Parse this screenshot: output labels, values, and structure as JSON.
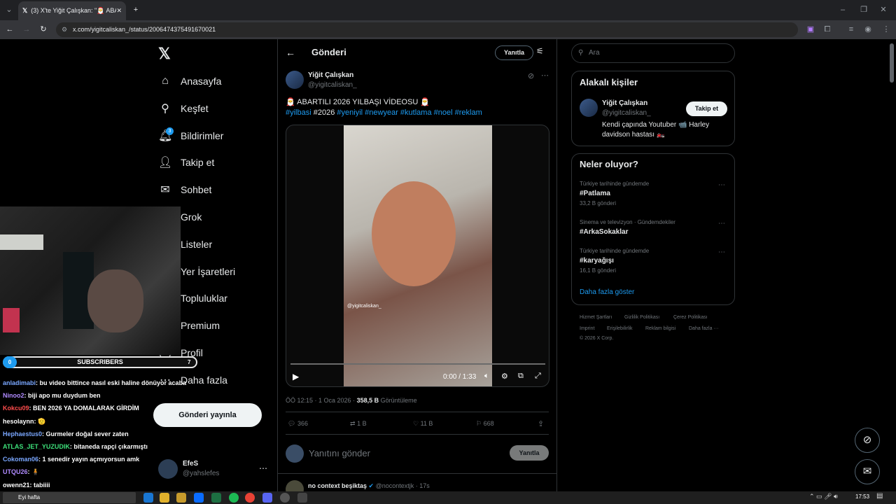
{
  "browser": {
    "tab_title": "(3) X'te Yiğit Çalışkan: \"🎅 ABA",
    "url": "x.com/yigitcaliskan_/status/2006474375491670021"
  },
  "sidebar": {
    "items": [
      {
        "label": "Anasayfa",
        "icon": "home-icon",
        "glyph": "⌂"
      },
      {
        "label": "Keşfet",
        "icon": "search-icon",
        "glyph": "⚲"
      },
      {
        "label": "Bildirimler",
        "icon": "bell-icon",
        "glyph": "🔔︎",
        "badge": "3"
      },
      {
        "label": "Takip et",
        "icon": "follow-icon",
        "glyph": "👤︎"
      },
      {
        "label": "Sohbet",
        "icon": "mail-icon",
        "glyph": "✉"
      },
      {
        "label": "Grok",
        "icon": "grok-icon",
        "glyph": "◪"
      },
      {
        "label": "Listeler",
        "icon": "list-icon",
        "glyph": "☰"
      },
      {
        "label": "Yer İşaretleri",
        "icon": "bookmark-icon",
        "glyph": "⚑"
      },
      {
        "label": "Topluluklar",
        "icon": "communities-icon",
        "glyph": "⚇"
      },
      {
        "label": "Premium",
        "icon": "premium-icon",
        "glyph": "✕"
      },
      {
        "label": "Profil",
        "icon": "profile-icon",
        "glyph": "◯"
      },
      {
        "label": "Daha fazla",
        "icon": "more-icon",
        "glyph": "⋯"
      }
    ],
    "post_button": "Gönderi yayınla",
    "account": {
      "name": "EfeS",
      "handle": "@yahslefes"
    }
  },
  "post": {
    "header": "Gönderi",
    "reply_btn": "Yanıtla",
    "author": "Yiğit Çalışkan",
    "handle": "@yigitcaliskan_",
    "text": "🎅 ABARTILI 2026 YILBAŞI VİDEOSU 🎅",
    "hashtag1": "#yilbasi",
    "plain_tag": "#2026",
    "hashtag2": "#yeniyil",
    "hashtag3": "#newyear",
    "hashtag4": "#kutlama",
    "hashtag5": "#noel",
    "hashtag6": "#reklam",
    "video_watermark": "@yigitcaliskan_",
    "video_time": "0:00 / 1:33",
    "progress": 0,
    "meta_time": "ÖÖ 12:15 · 1 Oca 2026 · ",
    "views": "358,5 B",
    "views_label": "Görüntüleme",
    "replies": "366",
    "reposts": "1 B",
    "likes": "11 B",
    "bookmarks": "668",
    "reply_placeholder": "Yanıtını gönder",
    "reply_submit": "Yanıtla",
    "next_author": "no context beşiktaş",
    "next_handle": "@nocontextjk · 17s"
  },
  "right": {
    "search_placeholder": "Ara",
    "related_title": "Alakalı kişiler",
    "related_name": "Yiğit Çalışkan",
    "related_handle": "@yigitcaliskan_",
    "follow_btn": "Takip et",
    "related_bio": "Kendi çapında Youtuber 📹 Harley davidson hastası 🏍️",
    "trends_title": "Neler oluyor?",
    "trends": [
      {
        "context": "Türkiye tarihinde gündemde",
        "name": "#Patlama",
        "count": "33,2 B gönderi"
      },
      {
        "context": "Sinema ve televizyon · Gündemdekiler",
        "name": "#ArkaSokaklar",
        "count": ""
      },
      {
        "context": "Türkiye tarihinde gündemde",
        "name": "#karyağışı",
        "count": "16,1 B gönderi"
      }
    ],
    "show_more": "Daha fazla göster",
    "footer": [
      "Hizmet Şartları",
      "Gizlilik Politikası",
      "Çerez Politikası",
      "Imprint",
      "Erişilebilirlik",
      "Reklam bilgisi",
      "Daha fazla ···",
      "© 2026 X Corp."
    ]
  },
  "overlay": {
    "sub_left": "0",
    "sub_label": "SUBSCRIBERS",
    "sub_right": "7",
    "chat": [
      {
        "user": "anladimabi",
        "color": "#7aa7ff",
        "msg": ": bu video bittince nasıl eski haline dönüyor acaba"
      },
      {
        "user": "Ninoo2",
        "color": "#b08bff",
        "msg": ": biji apo mu duydum ben"
      },
      {
        "user": "Kokcu09",
        "color": "#ff4d4d",
        "msg": ": BEN 2026 YA DOMALARAK GİRDİM"
      },
      {
        "user": "hesolaynn",
        "color": "#ffffff",
        "msg": ": 🫡"
      },
      {
        "user": "Hephaestus0",
        "color": "#7aa7ff",
        "msg": ": Gurmeler doğal sever zaten"
      },
      {
        "user": "ATLAS_JET_YUZUDIK",
        "color": "#3de07a",
        "msg": ": bitaneda rapçi çıkarmıştı"
      },
      {
        "user": "Cokoman06",
        "color": "#7aa7ff",
        "msg": ": 1 senedir yayın açmıyorsun amk"
      },
      {
        "user": "UTQU26",
        "color": "#b08bff",
        "msg": ": 🧍"
      },
      {
        "user": "owenn21",
        "color": "#ffffff",
        "msg": ": tabiiii"
      }
    ]
  },
  "taskbar": {
    "start_label": "Eyi hafta",
    "time": "17:53"
  },
  "colors": {
    "accent": "#1d9bf0",
    "bg": "#000000",
    "border": "#2f3336"
  }
}
